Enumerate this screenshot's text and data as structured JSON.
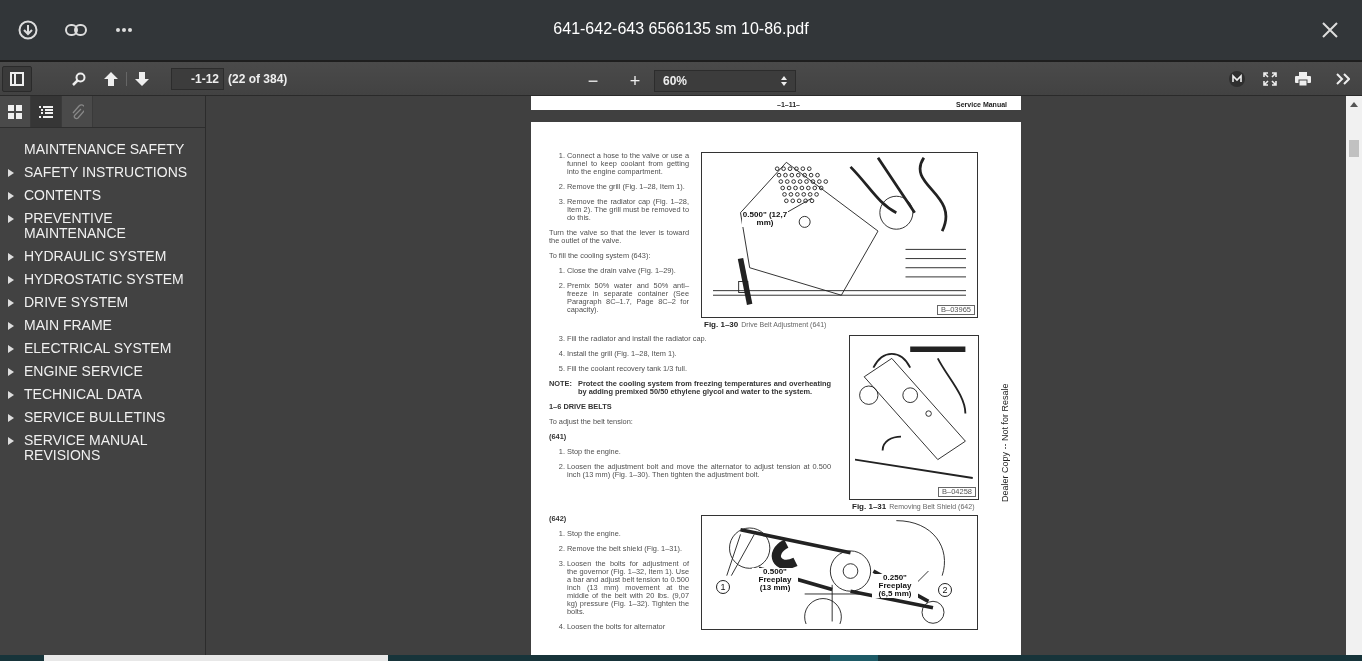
{
  "topbar": {
    "title": "641-642-643 6566135 sm 10-86.pdf"
  },
  "toolbar": {
    "page_field": {
      "value": "-1-12"
    },
    "page_count": "(22 of 384)",
    "zoom_minus": "−",
    "zoom_plus": "+",
    "zoom_select": {
      "value": "60%"
    }
  },
  "sidebar": {
    "tabs": [
      {
        "kind": "thumbnails",
        "selected": false,
        "disabled": false
      },
      {
        "kind": "outline",
        "selected": true,
        "disabled": false
      },
      {
        "kind": "attachments",
        "selected": false,
        "disabled": true
      }
    ],
    "items": [
      {
        "label": "MAINTENANCE SAFETY",
        "kind": "leaf"
      },
      {
        "label": "SAFETY INSTRUCTIONS",
        "kind": "branch"
      },
      {
        "label": "CONTENTS",
        "kind": "branch"
      },
      {
        "label": "PREVENTIVE MAINTENANCE",
        "kind": "branch"
      },
      {
        "label": "HYDRAULIC SYSTEM",
        "kind": "branch"
      },
      {
        "label": "HYDROSTATIC SYSTEM",
        "kind": "branch"
      },
      {
        "label": "DRIVE SYSTEM",
        "kind": "branch"
      },
      {
        "label": "MAIN FRAME",
        "kind": "branch"
      },
      {
        "label": "ELECTRICAL SYSTEM",
        "kind": "branch"
      },
      {
        "label": "ENGINE SERVICE",
        "kind": "branch"
      },
      {
        "label": "TECHNICAL DATA",
        "kind": "branch"
      },
      {
        "label": "SERVICE BULLETINS",
        "kind": "branch"
      },
      {
        "label": "SERVICE MANUAL REVISIONS",
        "kind": "branch"
      }
    ]
  },
  "previous_page": {
    "page_number": "–1–11–",
    "footer": "Service Manual"
  },
  "page": {
    "watermark": "Dealer Copy -- Not for Resale",
    "rows": [
      {
        "blocks": [
          {
            "kind": "step",
            "number": "1.",
            "text": "Connect a hose to the valve or use a funnel to keep coolant from getting into the engine compartment."
          },
          {
            "kind": "step",
            "number": "2.",
            "text": "Remove the grill (Fig. 1–28, Item 1)."
          },
          {
            "kind": "step",
            "number": "3.",
            "text": "Remove the radiator cap (Fig. 1–28, Item 2). The grill must be removed to do this."
          },
          {
            "kind": "para",
            "text": "Turn the valve so that the lever is toward the outlet of the valve."
          },
          {
            "kind": "para",
            "text": "To fill the cooling system (643):"
          },
          {
            "kind": "step",
            "number": "1.",
            "text": "Close the drain valve (Fig. 1–29)."
          },
          {
            "kind": "step",
            "number": "2.",
            "text": "Premix 50% water and 50% anti–freeze in separate container (See Paragraph 8C–1.7, Page 8C–2 for capacity)."
          }
        ],
        "figure": {
          "kind": "fan",
          "number": "Fig. 1–30",
          "title": "Drive Belt Adjustment (641)",
          "code": "B–03965",
          "labels": [
            {
              "text": "0.500\" (12,7 mm)"
            }
          ]
        }
      },
      {
        "blocks": [
          {
            "kind": "step",
            "number": "3.",
            "text": "Fill the radiator and install the radiator cap."
          },
          {
            "kind": "step",
            "number": "4.",
            "text": "Install the grill (Fig. 1–28, Item 1)."
          },
          {
            "kind": "step",
            "number": "5.",
            "text": "Fill the coolant recovery tank 1/3 full."
          },
          {
            "kind": "note",
            "label": "NOTE:",
            "text": "Protect the cooling system from freezing temperatures and overheating by adding premixed 50/50 ethylene glycol and water to the system."
          },
          {
            "kind": "heading",
            "text": "1–6 DRIVE BELTS"
          },
          {
            "kind": "para",
            "text": "To adjust the belt tension:"
          },
          {
            "kind": "heading",
            "text": "(641)"
          },
          {
            "kind": "step",
            "number": "1.",
            "text": "Stop the engine."
          },
          {
            "kind": "step",
            "number": "2.",
            "text": "Loosen the adjustment bolt and move the alternator to adjust tension at 0.500 inch (13 mm) (Fig. 1–30). Then tighten the adjustment bolt."
          }
        ],
        "figure": {
          "kind": "shield",
          "number": "Fig. 1–31",
          "title": "Removing Belt Shield (642)",
          "code": "B–04258"
        }
      },
      {
        "blocks": [
          {
            "kind": "heading",
            "text": "(642)"
          },
          {
            "kind": "step",
            "number": "1.",
            "text": "Stop the engine."
          },
          {
            "kind": "step",
            "number": "2.",
            "text": "Remove the belt shield (Fig. 1–31)."
          },
          {
            "kind": "step",
            "number": "3.",
            "text": "Loosen the bolts for adjustment of the governor (Fig. 1–32, Item 1). Use a bar and adjust belt tension to 0.500 inch (13 mm) movement at the middle of the belt with 20 lbs. (9,07 kg) pressure (Fig. 1–32). Tighten the bolts."
          },
          {
            "kind": "step",
            "number": "4.",
            "text": "Loosen the bolts for alternator"
          }
        ],
        "figure": {
          "kind": "belts",
          "labels": [
            {
              "text": "0.500\" Freeplay (13 mm)"
            },
            {
              "text": "0.250\" Freeplay (6,5 mm)"
            }
          ],
          "callouts": [
            "1",
            "2"
          ]
        }
      }
    ]
  }
}
